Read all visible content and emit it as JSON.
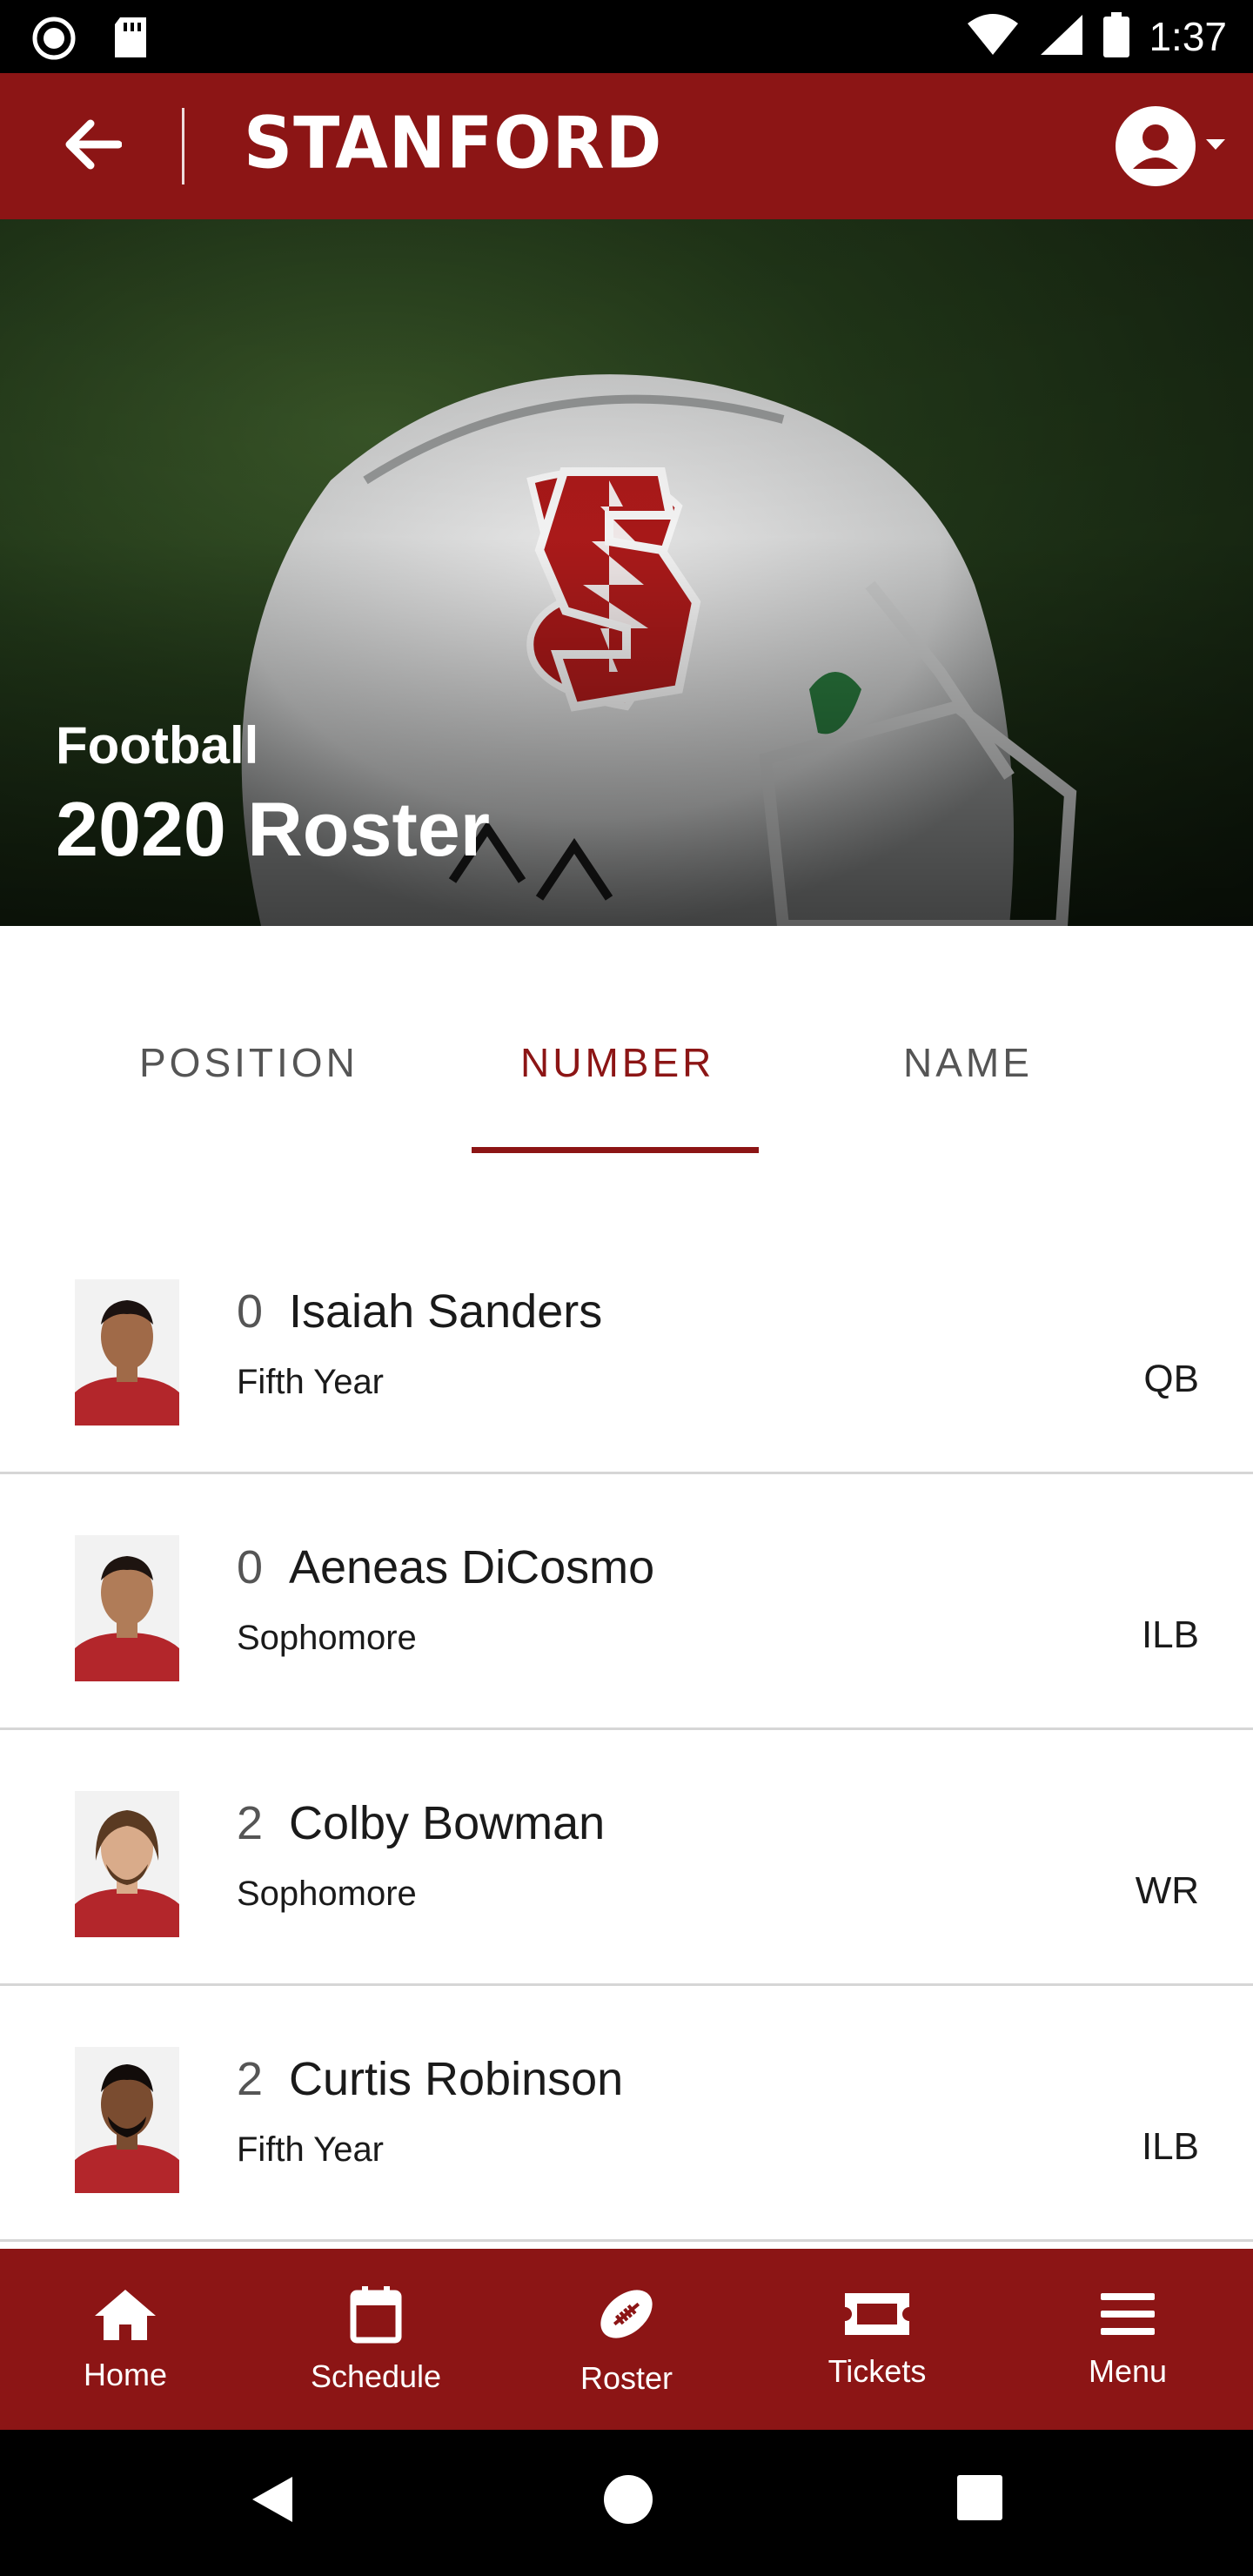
{
  "status_bar": {
    "time": "1:37",
    "left_icons": [
      "record-icon",
      "sd-card-icon"
    ],
    "right_icons": [
      "wifi-icon",
      "signal-icon",
      "battery-icon"
    ]
  },
  "app_bar": {
    "brand": "STANFORD",
    "back_icon": "arrow-left-icon",
    "account_icon": "account-circle-icon"
  },
  "hero": {
    "subtitle": "Football",
    "title": "2020 Roster"
  },
  "tabs": [
    {
      "label": "POSITION",
      "active": false
    },
    {
      "label": "NUMBER",
      "active": true
    },
    {
      "label": "NAME",
      "active": false
    }
  ],
  "roster": [
    {
      "number": "0",
      "name": "Isaiah Sanders",
      "year": "Fifth Year",
      "position": "QB",
      "skin": "#a06a48",
      "hair": "#1b1210"
    },
    {
      "number": "0",
      "name": "Aeneas DiCosmo",
      "year": "Sophomore",
      "position": "ILB",
      "skin": "#b07c58",
      "hair": "#1e1410"
    },
    {
      "number": "2",
      "name": "Colby Bowman",
      "year": "Sophomore",
      "position": "WR",
      "skin": "#d9ab8a",
      "hair": "#5a3a22"
    },
    {
      "number": "2",
      "name": "Curtis Robinson",
      "year": "Fifth Year",
      "position": "ILB",
      "skin": "#7a4c30",
      "hair": "#120c0a"
    }
  ],
  "bottom_nav": [
    {
      "label": "Home",
      "icon": "home-icon",
      "active": false
    },
    {
      "label": "Schedule",
      "icon": "calendar-icon",
      "active": false
    },
    {
      "label": "Roster",
      "icon": "football-icon",
      "active": true
    },
    {
      "label": "Tickets",
      "icon": "ticket-icon",
      "active": false
    },
    {
      "label": "Menu",
      "icon": "menu-icon",
      "active": false
    }
  ],
  "colors": {
    "brand": "#8c1515",
    "divider": "#d6d6d6",
    "text": "#1a1a1a"
  }
}
